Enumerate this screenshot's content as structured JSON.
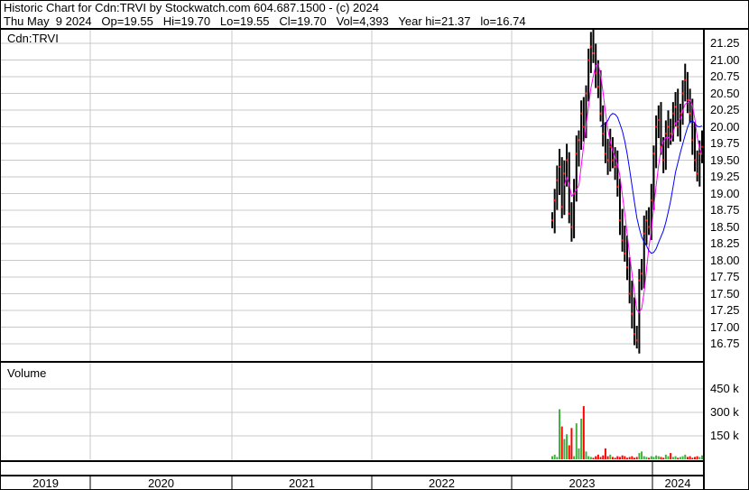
{
  "header": {
    "title": "Historic Chart for Cdn:TRVI by Stockwatch.com 604.687.1500 - (c) 2024",
    "quote": "Thu May  9 2024   Op=19.55   Hi=19.70   Lo=19.55   Cl=19.70   Vol=4,393   Year hi=21.37   lo=16.74"
  },
  "chart_data": {
    "type": "line",
    "title": "Cdn:TRVI",
    "volume_label": "Volume",
    "price_ticks": [
      "21.25",
      "21.00",
      "20.75",
      "20.50",
      "20.25",
      "20.00",
      "19.75",
      "19.50",
      "19.25",
      "19.00",
      "18.75",
      "18.50",
      "18.25",
      "18.00",
      "17.75",
      "17.50",
      "17.25",
      "17.00",
      "16.75"
    ],
    "ylim": [
      16.65,
      21.45
    ],
    "volume_ticks": [
      "450 k",
      "300 k",
      "150 k"
    ],
    "volume_ylim": [
      0,
      600000
    ],
    "years": [
      "2019",
      "2020",
      "2021",
      "2022",
      "2023",
      "2024"
    ],
    "series_colors": {
      "price": "#000000",
      "close_mark": "#ff0000",
      "ma_short": "#ff00ff",
      "ma_long": "#0000ff",
      "vol_up": "#40b040",
      "vol_down": "#ff0000"
    },
    "close": [
      18.6,
      18.9,
      19.2,
      19.4,
      18.8,
      19.3,
      19.5,
      18.7,
      18.5,
      19.0,
      19.6,
      19.8,
      20.2,
      20.0,
      20.5,
      21.0,
      21.2,
      21.1,
      20.8,
      20.6,
      20.2,
      19.9,
      19.6,
      19.5,
      19.7,
      19.5,
      19.4,
      19.1,
      18.6,
      18.3,
      18.1,
      17.9,
      17.5,
      17.2,
      16.9,
      16.8,
      17.7,
      17.8,
      18.4,
      18.6,
      18.5,
      18.9,
      19.6,
      20.0,
      20.1,
      19.7,
      19.5,
      19.9,
      20.0,
      19.9,
      20.2,
      20.3,
      20.0,
      20.2,
      20.5,
      20.7,
      20.4,
      20.2,
      19.8,
      19.5,
      19.3,
      19.6,
      19.7
    ],
    "volume": [
      20000,
      30000,
      15000,
      320000,
      210000,
      130000,
      160000,
      90000,
      200000,
      20000,
      230000,
      70000,
      260000,
      340000,
      50000,
      20000,
      15000,
      10000,
      20000,
      30000,
      15000,
      25000,
      70000,
      20000,
      30000,
      15000,
      10000,
      20000,
      15000,
      25000,
      20000,
      10000,
      15000,
      20000,
      10000,
      15000,
      40000,
      50000,
      20000,
      15000,
      10000,
      20000,
      15000,
      25000,
      20000,
      15000,
      10000,
      30000,
      20000,
      40000,
      15000,
      20000,
      10000,
      15000,
      20000,
      30000,
      15000,
      20000,
      10000,
      15000,
      20000,
      15000,
      25000
    ]
  }
}
